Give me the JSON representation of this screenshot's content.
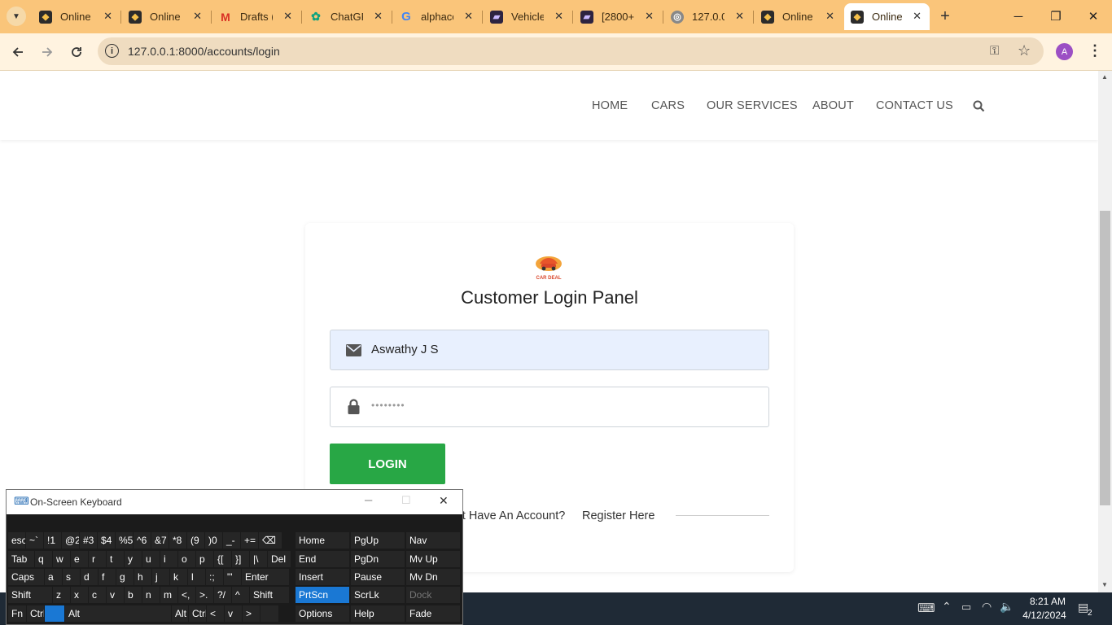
{
  "browser": {
    "tabs": [
      {
        "title": "Online",
        "icon": "site-logo-icon"
      },
      {
        "title": "Online",
        "icon": "site-logo-icon"
      },
      {
        "title": "Drafts (",
        "icon": "gmail-icon"
      },
      {
        "title": "ChatGP",
        "icon": "chatgpt-icon"
      },
      {
        "title": "alphacc",
        "icon": "google-icon"
      },
      {
        "title": "Vehicle",
        "icon": "vehicle-site-icon"
      },
      {
        "title": "[2800+]",
        "icon": "vehicle-site-icon"
      },
      {
        "title": "127.0.0",
        "icon": "globe-icon"
      },
      {
        "title": "Online",
        "icon": "site-logo-icon"
      },
      {
        "title": "Online",
        "icon": "site-logo-icon"
      }
    ],
    "url": "127.0.0.1:8000/accounts/login",
    "profile_initial": "A",
    "accent": "#fac57a"
  },
  "site": {
    "nav": [
      "HOME",
      "CARS",
      "OUR SERVICES",
      "ABOUT",
      "CONTACT US"
    ],
    "logo_text": "CAR DEAL"
  },
  "login": {
    "title": "Customer Login Panel",
    "username_value": "Aswathy J S",
    "password_value": "••••••••",
    "button_label": "LOGIN",
    "button_color": "#28a745",
    "signup_prompt": "Don't Have An Account?",
    "signup_prompt_visible": "'t Have An Account?",
    "signup_link": "Register Here"
  },
  "osk": {
    "title": "On-Screen Keyboard",
    "row1": [
      "esc",
      "~`",
      "!1",
      "@2",
      "#3",
      "$4",
      "%5",
      "^6",
      "&7",
      "*8",
      "(9",
      ")0",
      "_-",
      "+=",
      "⌫"
    ],
    "row2": [
      "Tab",
      "q",
      "w",
      "e",
      "r",
      "t",
      "y",
      "u",
      "i",
      "o",
      "p",
      "{[",
      "}]",
      "|\\",
      "Del"
    ],
    "row3": [
      "Caps",
      "a",
      "s",
      "d",
      "f",
      "g",
      "h",
      "j",
      "k",
      "l",
      ":;",
      "\"'",
      "Enter"
    ],
    "row4": [
      "Shift",
      "z",
      "x",
      "c",
      "v",
      "b",
      "n",
      "m",
      "<,",
      ">.",
      "?/",
      "^",
      "Shift"
    ],
    "row5": [
      "Fn",
      "Ctrl",
      "",
      "Alt",
      "",
      "Alt",
      "Ctrl",
      "<",
      "v",
      ">",
      ""
    ],
    "nav_keys": [
      [
        "Home",
        "PgUp",
        "Nav"
      ],
      [
        "End",
        "PgDn",
        "Mv Up"
      ],
      [
        "Insert",
        "Pause",
        "Mv Dn"
      ],
      [
        "PrtScn",
        "ScrLk",
        "Dock"
      ],
      [
        "Options",
        "Help",
        "Fade"
      ]
    ]
  },
  "taskbar": {
    "time": "8:21 AM",
    "date": "4/12/2024",
    "notification_count": "2"
  }
}
